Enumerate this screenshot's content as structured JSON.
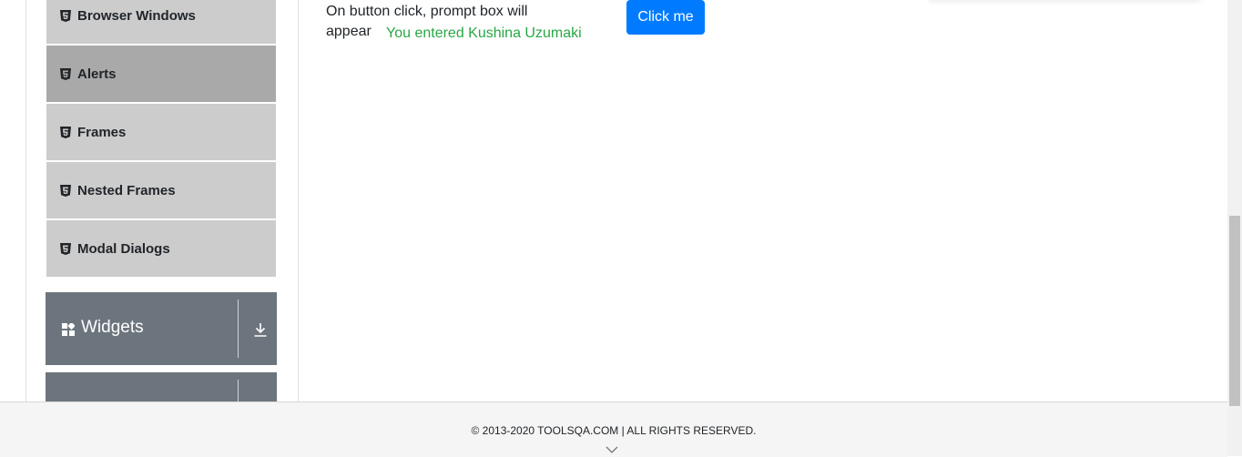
{
  "sidebar": {
    "items": [
      {
        "label": "Browser Windows",
        "icon": "html5-icon"
      },
      {
        "label": "Alerts",
        "icon": "html5-icon",
        "active": true
      },
      {
        "label": "Frames",
        "icon": "html5-icon"
      },
      {
        "label": "Nested Frames",
        "icon": "html5-icon"
      },
      {
        "label": "Modal Dialogs",
        "icon": "html5-icon"
      }
    ],
    "groups": [
      {
        "label": "Widgets",
        "icon": "widgets-icon",
        "toggle_icon": "download-arrow-icon"
      },
      {
        "label": "",
        "icon": "",
        "toggle_icon": ""
      }
    ]
  },
  "main": {
    "prompt_label": "On button click, prompt box will appear",
    "prompt_result": "You entered Kushina Uzumaki",
    "click_button_label": "Click me"
  },
  "footer": {
    "copyright": "© 2013-2020 TOOLSQA.COM | ALL RIGHTS RESERVED.",
    "scroll_icon": "chevron-down-icon"
  },
  "colors": {
    "menu_bg": "#cccccc",
    "menu_active_bg": "#a9a9a9",
    "group_bg": "#6c757d",
    "button_primary": "#007bff",
    "success_text": "#28a745"
  }
}
